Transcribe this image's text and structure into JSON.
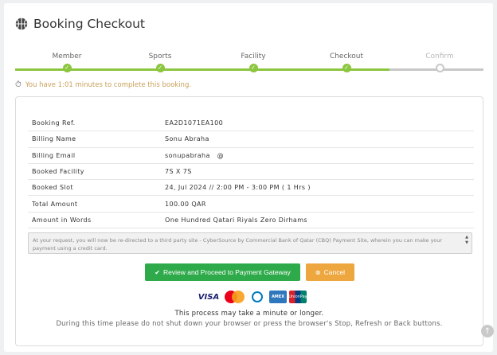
{
  "header": {
    "title": "Booking Checkout",
    "logo_icon": "basketball-icon"
  },
  "stepper": {
    "steps": [
      {
        "label": "Member",
        "status": "done"
      },
      {
        "label": "Sports",
        "status": "done"
      },
      {
        "label": "Facility",
        "status": "done"
      },
      {
        "label": "Checkout",
        "status": "done"
      },
      {
        "label": "Confirm",
        "status": "pending"
      }
    ],
    "done_color": "#8cc63f",
    "pending_color": "#c8c8c8"
  },
  "timer": {
    "icon": "stopwatch-icon",
    "text": "You have 1:01 minutes to complete this booking."
  },
  "details": [
    {
      "label": "Booking Ref.",
      "value": "EA2D1071EA100"
    },
    {
      "label": "Billing Name",
      "value": "Sonu Abraha"
    },
    {
      "label": "Billing Email",
      "value": "sonupabraha   @"
    },
    {
      "label": "Booked Facility",
      "value": "7S X 7S"
    },
    {
      "label": "Booked Slot",
      "value": "24, Jul 2024 // 2:00 PM - 3:00 PM ( 1 Hrs )"
    },
    {
      "label": "Total Amount",
      "value": "100.00 QAR"
    },
    {
      "label": "Amount in Words",
      "value": "One Hundred Qatari Riyals Zero Dirhams"
    }
  ],
  "notice": {
    "text": "At your request, you will now be re-directed to a third party site - CyberSource by Commercial Bank of Qatar (CBQ) Payment Site, wherein you can make your payment using a credit card."
  },
  "buttons": {
    "pay_label": "Review and Proceed to Payment Gateway",
    "cancel_label": "Cancel",
    "pay_color": "#2eaa4a",
    "cancel_color": "#eea63e"
  },
  "payment_logos": {
    "visa": "VISA",
    "amex": "AMEX",
    "unionpay": "UnionPay"
  },
  "messages": {
    "line1": "This process may take a minute or longer.",
    "line2": "During this time please do not shut down your browser or press the browser's Stop, Refresh or Back buttons."
  }
}
